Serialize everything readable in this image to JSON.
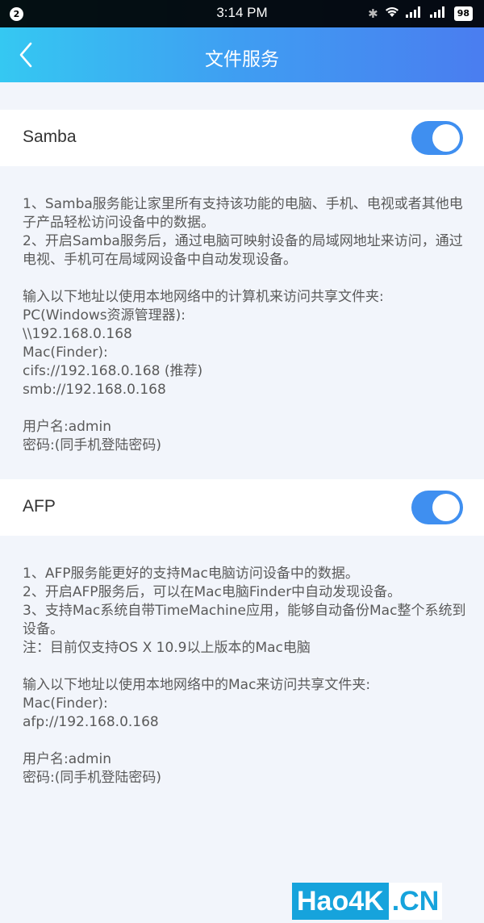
{
  "status_bar": {
    "notification_count": "2",
    "time": "3:14 PM",
    "battery": "98"
  },
  "nav": {
    "title": "文件服务"
  },
  "samba": {
    "label": "Samba",
    "enabled": true,
    "lines": [
      "1、Samba服务能让家里所有支持该功能的电脑、手机、电视或者其他电子产品轻松访问设备中的数据。",
      "2、开启Samba服务后，通过电脑可映射设备的局域网地址来访问，通过电视、手机可在局域网设备中自动发现设备。",
      "",
      "输入以下地址以使用本地网络中的计算机来访问共享文件夹:",
      "PC(Windows资源管理器):",
      "\\\\192.168.0.168",
      "Mac(Finder):",
      "cifs://192.168.0.168 (推荐)",
      "smb://192.168.0.168",
      "",
      "用户名:admin",
      "密码:(同手机登陆密码)"
    ]
  },
  "afp": {
    "label": "AFP",
    "enabled": true,
    "lines": [
      "1、AFP服务能更好的支持Mac电脑访问设备中的数据。",
      "2、开启AFP服务后，可以在Mac电脑Finder中自动发现设备。",
      "3、支持Mac系统自带TimeMachine应用，能够自动备份Mac整个系统到设备。",
      "注：目前仅支持OS X 10.9以上版本的Mac电脑",
      "",
      "输入以下地址以使用本地网络中的Mac来访问共享文件夹:",
      "Mac(Finder):",
      "afp://192.168.0.168",
      "",
      "用户名:admin",
      "密码:(同手机登陆密码)"
    ]
  },
  "watermark": {
    "part1": "Hao4K",
    "part2": ".CN"
  },
  "icons": {
    "back": "chevron-left-icon",
    "bluetooth": "bluetooth-icon",
    "wifi": "wifi-icon",
    "signal": "signal-icon"
  }
}
